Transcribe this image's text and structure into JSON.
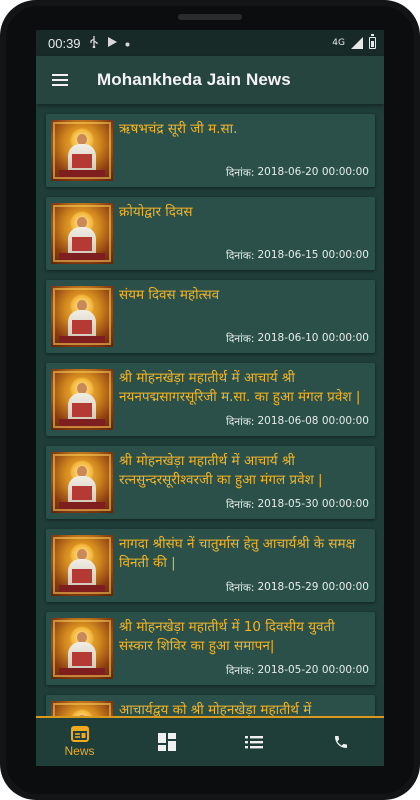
{
  "status_bar": {
    "time": "00:39",
    "network": "4G",
    "icons": [
      "usb-icon",
      "play-icon",
      "dot-icon"
    ]
  },
  "app_bar": {
    "title": "Mohankheda Jain News",
    "menu_icon": "hamburger-menu-icon"
  },
  "news": [
    {
      "title": "ऋषभचंद्र सूरी जी म.सा.",
      "date_label": "दिनांक:",
      "date": "2018-06-20 00:00:00"
    },
    {
      "title": "क्रोयोद्वार दिवस",
      "date_label": "दिनांक:",
      "date": "2018-06-15 00:00:00"
    },
    {
      "title": "संयम दिवस महोत्सव",
      "date_label": "दिनांक:",
      "date": "2018-06-10 00:00:00"
    },
    {
      "title": "श्री मोहनखेड़ा महातीर्थ में आचार्य श्री नयनपद्मसागरसूरिजी म.सा. का हुआ मंगल प्रवेश |",
      "date_label": "दिनांक:",
      "date": "2018-06-08 00:00:00"
    },
    {
      "title": "श्री मोहनखेड़ा महातीर्थ में आचार्य श्री रत्नसुन्दरसूरीश्वरजी का हुआ मंगल प्रवेश |",
      "date_label": "दिनांक:",
      "date": "2018-05-30 00:00:00"
    },
    {
      "title": "नागदा श्रीसंघ नें चातुर्मास हेतु आचार्यश्री के समक्ष विनती की |",
      "date_label": "दिनांक:",
      "date": "2018-05-29 00:00:00"
    },
    {
      "title": "श्री मोहनखेड़ा महातीर्थ में 10 दिवसीय युवती संस्कार शिविर का हुआ समापन|",
      "date_label": "दिनांक:",
      "date": "2018-05-20 00:00:00"
    },
    {
      "title": "आचार्यद्वय को श्री मोहनखेड़ा महातीर्थ में",
      "date_label": "",
      "date": ""
    }
  ],
  "bottom_nav": {
    "items": [
      {
        "label": "News",
        "icon": "news-icon",
        "active": true
      },
      {
        "label": "",
        "icon": "dashboard-icon",
        "active": false
      },
      {
        "label": "",
        "icon": "list-icon",
        "active": false
      },
      {
        "label": "",
        "icon": "phone-icon",
        "active": false
      }
    ]
  },
  "colors": {
    "background": "#1f3d39",
    "card": "#2a5049",
    "accent": "#f0b429",
    "nav_border": "#d89a1c"
  }
}
